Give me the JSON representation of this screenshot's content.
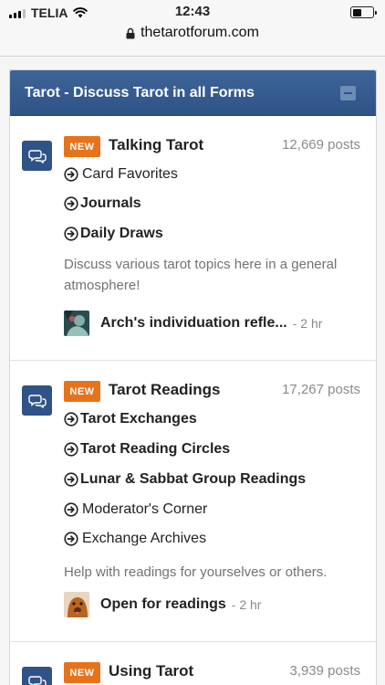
{
  "status_bar": {
    "carrier": "TELIA",
    "time": "12:43",
    "battery_level": 0.45
  },
  "url": "thetarotforum.com",
  "panel": {
    "title": "Tarot - Discuss Tarot in all Forms"
  },
  "forums": [
    {
      "badge": "NEW",
      "title": "Talking Tarot",
      "posts": "12,669 posts",
      "subforums": [
        {
          "label": "Card Favorites",
          "bold": false
        },
        {
          "label": "Journals",
          "bold": true
        },
        {
          "label": "Daily Draws",
          "bold": true
        }
      ],
      "description": "Discuss various tarot topics here in a general atmosphere!",
      "last_post": {
        "title": "Arch's individuation refle...",
        "time": "- 2 hr"
      }
    },
    {
      "badge": "NEW",
      "title": "Tarot Readings",
      "posts": "17,267 posts",
      "subforums": [
        {
          "label": "Tarot Exchanges",
          "bold": true
        },
        {
          "label": "Tarot Reading Circles",
          "bold": true
        },
        {
          "label": "Lunar & Sabbat Group Readings",
          "bold": true
        },
        {
          "label": "Moderator's Corner",
          "bold": false
        },
        {
          "label": "Exchange Archives",
          "bold": false
        }
      ],
      "description": "Help with readings for yourselves or others.",
      "last_post": {
        "title": "Open for readings",
        "time": "- 2 hr"
      }
    },
    {
      "badge": "NEW",
      "title": "Using Tarot",
      "posts": "3,939 posts"
    }
  ],
  "colors": {
    "header_blue": "#2f5387",
    "badge_orange": "#e8721c",
    "muted_text": "#8a8a8a"
  }
}
